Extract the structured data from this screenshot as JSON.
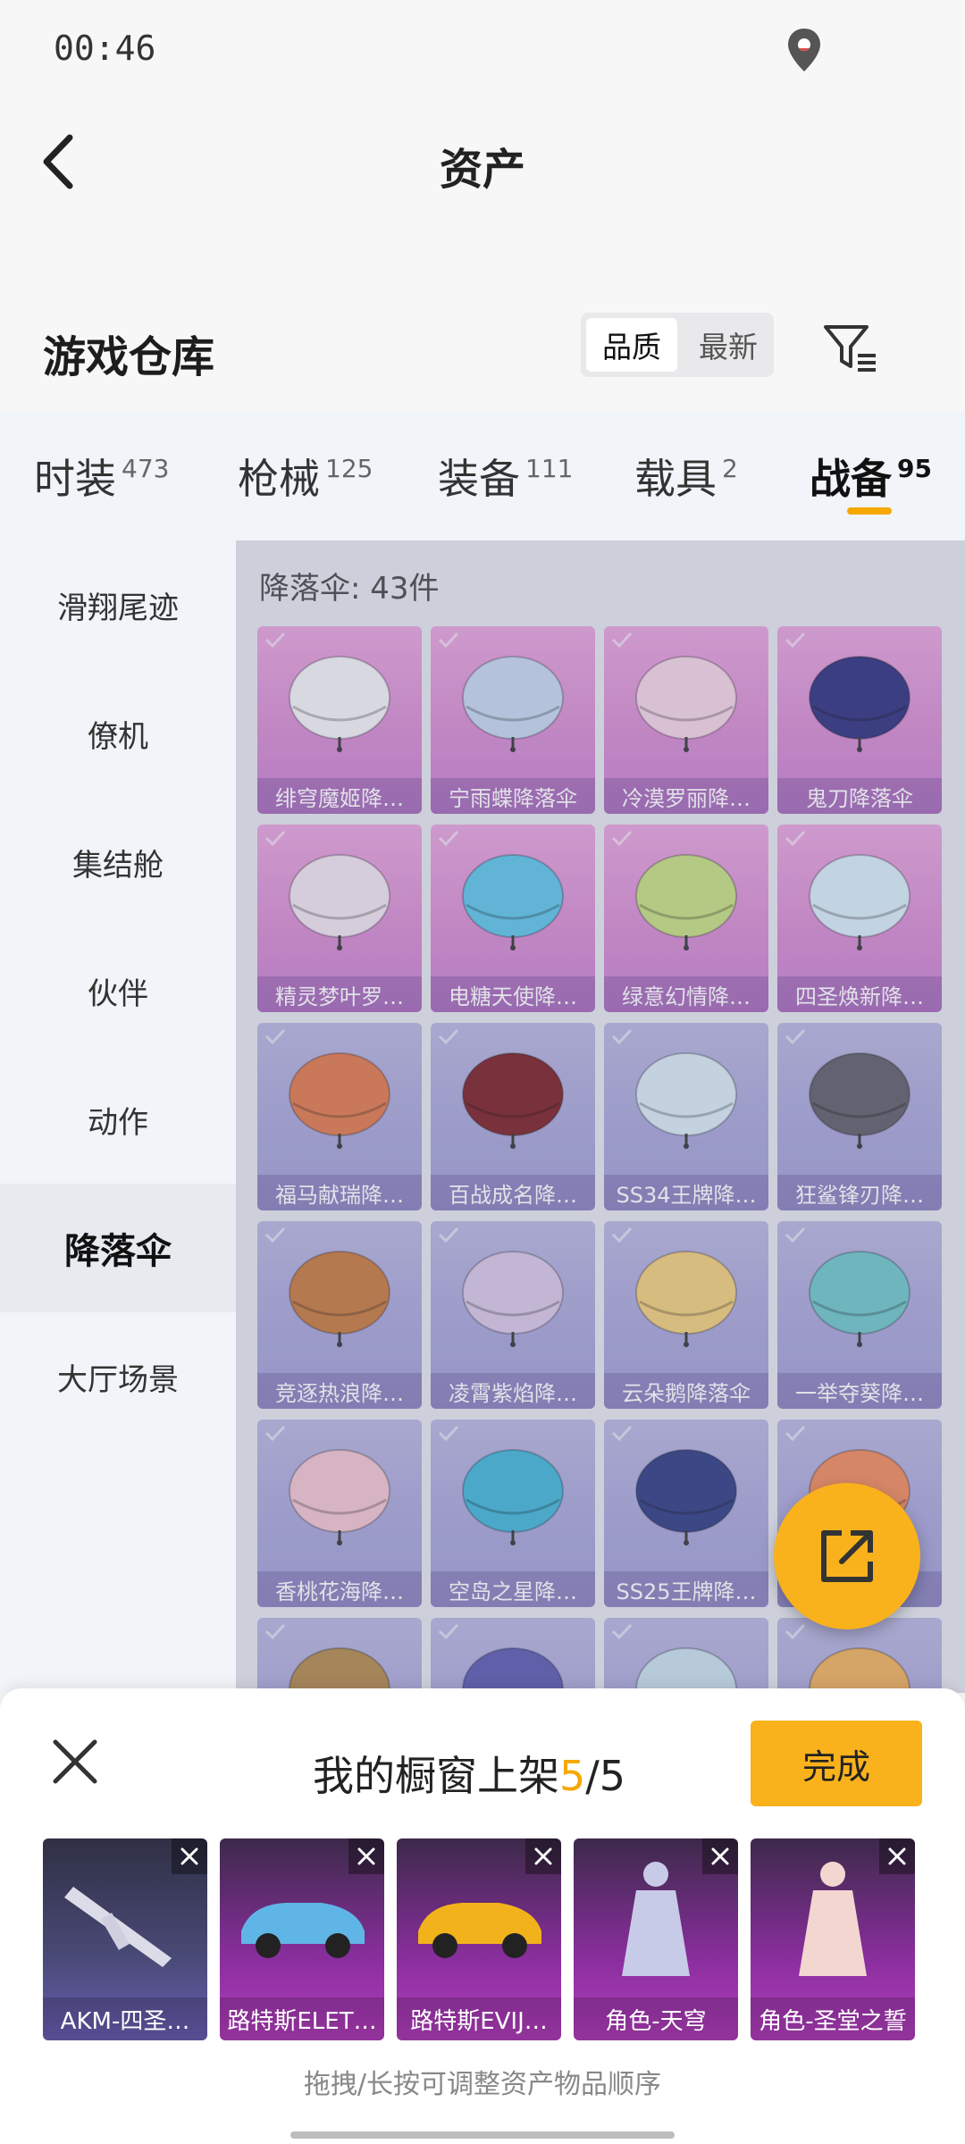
{
  "status": {
    "time": "00:46"
  },
  "nav": {
    "title": "资产"
  },
  "repo": {
    "title": "游戏仓库",
    "sort": [
      {
        "label": "品质",
        "active": true
      },
      {
        "label": "最新",
        "active": false
      }
    ]
  },
  "tabs": [
    {
      "label": "时装",
      "count": "473"
    },
    {
      "label": "枪械",
      "count": "125"
    },
    {
      "label": "装备",
      "count": "111"
    },
    {
      "label": "载具",
      "count": "2"
    },
    {
      "label": "战备",
      "count": "95",
      "active": true
    }
  ],
  "sidebar": [
    {
      "label": "滑翔尾迹"
    },
    {
      "label": "僚机"
    },
    {
      "label": "集结舱"
    },
    {
      "label": "伙伴"
    },
    {
      "label": "动作"
    },
    {
      "label": "降落伞",
      "active": true
    },
    {
      "label": "大厅场景"
    }
  ],
  "grid": {
    "count_label": "降落伞: 43件",
    "items": [
      {
        "name": "绯穹魔姬降…",
        "tier": "pink",
        "color": "#f4f4f6"
      },
      {
        "name": "宁雨蝶降落伞",
        "tier": "pink",
        "color": "#c6d8ef"
      },
      {
        "name": "冷漠罗丽降…",
        "tier": "pink",
        "color": "#f5d6e6"
      },
      {
        "name": "鬼刀降落伞",
        "tier": "pink",
        "color": "#2b2f7a"
      },
      {
        "name": "精灵梦叶罗…",
        "tier": "pink",
        "color": "#f0e6ef"
      },
      {
        "name": "电糖天使降…",
        "tier": "pink",
        "color": "#5bc6e8"
      },
      {
        "name": "绿意幻情降…",
        "tier": "pink",
        "color": "#c6e07f"
      },
      {
        "name": "四圣焕新降…",
        "tier": "pink",
        "color": "#d8eef6"
      },
      {
        "name": "福马献瑞降…",
        "tier": "blue",
        "color": "#e07a4a"
      },
      {
        "name": "百战成名降…",
        "tier": "blue",
        "color": "#7a1e22"
      },
      {
        "name": "SS34王牌降…",
        "tier": "blue",
        "color": "#d9ecf2"
      },
      {
        "name": "狂鲨锋刃降…",
        "tier": "blue",
        "color": "#5d5d66"
      },
      {
        "name": "竞逐热浪降…",
        "tier": "blue",
        "color": "#c77a3c"
      },
      {
        "name": "凌霄紫焰降…",
        "tier": "blue",
        "color": "#d8c8e6"
      },
      {
        "name": "云朵鹅降落伞",
        "tier": "blue",
        "color": "#f2d079"
      },
      {
        "name": "一举夺葵降…",
        "tier": "blue",
        "color": "#6ec7c9"
      },
      {
        "name": "香桃花海降…",
        "tier": "blue",
        "color": "#f2c6d0"
      },
      {
        "name": "空岛之星降…",
        "tier": "blue",
        "color": "#3fb6d6"
      },
      {
        "name": "SS25王牌降…",
        "tier": "blue",
        "color": "#2c3b80"
      },
      {
        "name": "",
        "tier": "blue",
        "color": "#f08b5a"
      },
      {
        "name": "",
        "tier": "blue",
        "color": "#b28a4a"
      },
      {
        "name": "",
        "tier": "blue",
        "color": "#5a5ab0"
      },
      {
        "name": "",
        "tier": "blue",
        "color": "#c8e2ec"
      },
      {
        "name": "",
        "tier": "blue",
        "color": "#f0b25a"
      }
    ]
  },
  "sheet": {
    "title_prefix": "我的橱窗上架",
    "current": "5",
    "separator": "/",
    "total": "5",
    "done_label": "完成",
    "hint": "拖拽/长按可调整资产物品顺序",
    "shelf": [
      {
        "label": "AKM-四圣…",
        "style": "dark"
      },
      {
        "label": "路特斯ELET…",
        "style": "mag"
      },
      {
        "label": "路特斯EVIJ…",
        "style": "mag"
      },
      {
        "label": "角色-天穹",
        "style": "mag"
      },
      {
        "label": "角色-圣堂之誓",
        "style": "mag"
      }
    ]
  },
  "colors": {
    "accent": "#f9b21c",
    "accent_text": "#f5a800"
  },
  "icons": [
    "back-arrow-icon",
    "location-icon",
    "filter-icon",
    "share-icon",
    "close-icon",
    "check-icon"
  ]
}
